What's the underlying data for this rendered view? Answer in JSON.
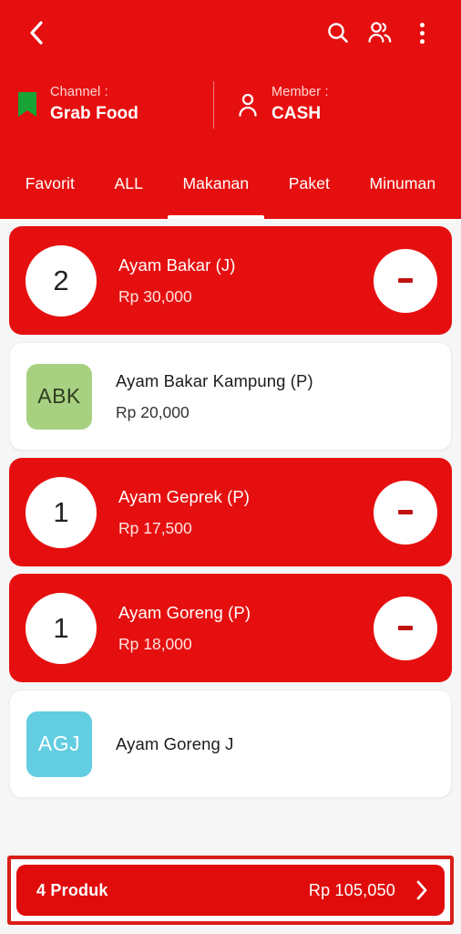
{
  "header": {
    "back_icon": "chevron-left-icon",
    "actions": [
      {
        "icon": "search-icon",
        "name": "search-button"
      },
      {
        "icon": "people-icon",
        "name": "members-button"
      },
      {
        "icon": "more-vertical-icon",
        "name": "more-options-button"
      }
    ],
    "channel": {
      "icon": "bookmark-icon",
      "icon_color": "#17a335",
      "label": "Channel :",
      "value": "Grab Food"
    },
    "member": {
      "icon": "person-icon",
      "label": "Member :",
      "value": "CASH"
    },
    "background_color": "#e60f0f"
  },
  "tabs": {
    "items": [
      {
        "label": "Favorit",
        "active": false
      },
      {
        "label": "ALL",
        "active": false
      },
      {
        "label": "Makanan",
        "active": true
      },
      {
        "label": "Paket",
        "active": false
      },
      {
        "label": "Minuman",
        "active": false
      }
    ]
  },
  "products": [
    {
      "name": "Ayam Bakar (J)",
      "price": "Rp 30,000",
      "qty": "2",
      "selected": true,
      "avatar_text": "",
      "avatar_color": "",
      "minus_label": "-"
    },
    {
      "name": "Ayam Bakar Kampung (P)",
      "price": "Rp 20,000",
      "qty": "",
      "selected": false,
      "avatar_text": "ABK",
      "avatar_color": "#a7d180",
      "minus_label": ""
    },
    {
      "name": "Ayam Geprek (P)",
      "price": "Rp 17,500",
      "qty": "1",
      "selected": true,
      "avatar_text": "",
      "avatar_color": "",
      "minus_label": "-"
    },
    {
      "name": "Ayam Goreng (P)",
      "price": "Rp 18,000",
      "qty": "1",
      "selected": true,
      "avatar_text": "",
      "avatar_color": "",
      "minus_label": "-"
    },
    {
      "name": "Ayam Goreng J",
      "price": "",
      "qty": "",
      "selected": false,
      "avatar_text": "AGJ",
      "avatar_color": "#63cde2",
      "minus_label": ""
    }
  ],
  "bottom_bar": {
    "count_label": "4 Produk",
    "total_label": "Rp 105,050",
    "chevron_icon": "chevron-right-icon",
    "highlight_color": "#d81f18",
    "background_color": "#e00c0c"
  }
}
